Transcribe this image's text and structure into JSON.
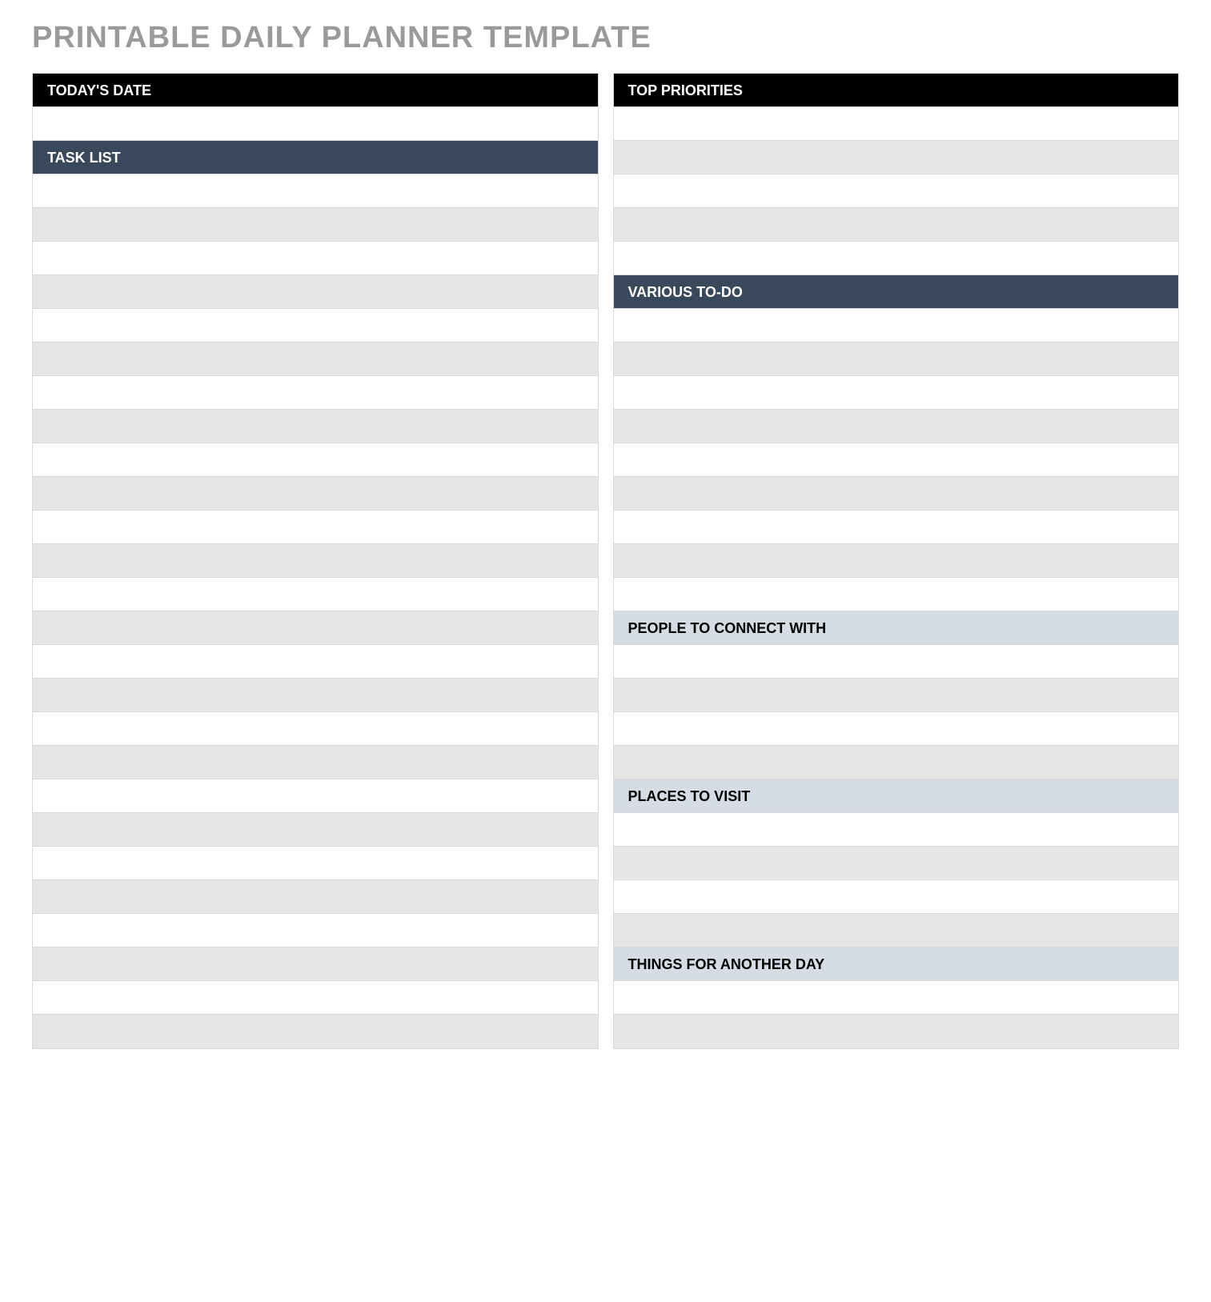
{
  "title": "PRINTABLE DAILY PLANNER TEMPLATE",
  "colors": {
    "title_text": "#9a9a9a",
    "header_black_bg": "#000000",
    "header_dark_bg": "#39485a",
    "header_blue_bg": "#d5dce4",
    "row_grey_bg": "#e6e6e6",
    "row_white_bg": "#ffffff",
    "border": "#d9d9d9"
  },
  "left_column": [
    {
      "type": "header_black",
      "label": "TODAY'S DATE"
    },
    {
      "type": "white",
      "label": ""
    },
    {
      "type": "header_dark",
      "label": "TASK LIST"
    },
    {
      "type": "white",
      "label": ""
    },
    {
      "type": "grey",
      "label": ""
    },
    {
      "type": "white",
      "label": ""
    },
    {
      "type": "grey",
      "label": ""
    },
    {
      "type": "white",
      "label": ""
    },
    {
      "type": "grey",
      "label": ""
    },
    {
      "type": "white",
      "label": ""
    },
    {
      "type": "grey",
      "label": ""
    },
    {
      "type": "white",
      "label": ""
    },
    {
      "type": "grey",
      "label": ""
    },
    {
      "type": "white",
      "label": ""
    },
    {
      "type": "grey",
      "label": ""
    },
    {
      "type": "white",
      "label": ""
    },
    {
      "type": "grey",
      "label": ""
    },
    {
      "type": "white",
      "label": ""
    },
    {
      "type": "grey",
      "label": ""
    },
    {
      "type": "white",
      "label": ""
    },
    {
      "type": "grey",
      "label": ""
    },
    {
      "type": "white",
      "label": ""
    },
    {
      "type": "grey",
      "label": ""
    },
    {
      "type": "white",
      "label": ""
    },
    {
      "type": "grey",
      "label": ""
    },
    {
      "type": "white",
      "label": ""
    },
    {
      "type": "grey",
      "label": ""
    },
    {
      "type": "white",
      "label": ""
    },
    {
      "type": "grey",
      "label": ""
    }
  ],
  "right_column": [
    {
      "type": "header_black",
      "label": "TOP PRIORITIES"
    },
    {
      "type": "white",
      "label": ""
    },
    {
      "type": "grey",
      "label": ""
    },
    {
      "type": "white",
      "label": ""
    },
    {
      "type": "grey",
      "label": ""
    },
    {
      "type": "white",
      "label": ""
    },
    {
      "type": "header_dark",
      "label": "VARIOUS TO-DO"
    },
    {
      "type": "white",
      "label": ""
    },
    {
      "type": "grey",
      "label": ""
    },
    {
      "type": "white",
      "label": ""
    },
    {
      "type": "grey",
      "label": ""
    },
    {
      "type": "white",
      "label": ""
    },
    {
      "type": "grey",
      "label": ""
    },
    {
      "type": "white",
      "label": ""
    },
    {
      "type": "grey",
      "label": ""
    },
    {
      "type": "white",
      "label": ""
    },
    {
      "type": "header_blue",
      "label": "PEOPLE TO CONNECT WITH"
    },
    {
      "type": "white",
      "label": ""
    },
    {
      "type": "grey",
      "label": ""
    },
    {
      "type": "white",
      "label": ""
    },
    {
      "type": "grey",
      "label": ""
    },
    {
      "type": "header_blue",
      "label": "PLACES TO VISIT"
    },
    {
      "type": "white",
      "label": ""
    },
    {
      "type": "grey",
      "label": ""
    },
    {
      "type": "white",
      "label": ""
    },
    {
      "type": "grey",
      "label": ""
    },
    {
      "type": "header_blue",
      "label": "THINGS FOR ANOTHER DAY"
    },
    {
      "type": "white",
      "label": ""
    },
    {
      "type": "grey",
      "label": ""
    }
  ]
}
